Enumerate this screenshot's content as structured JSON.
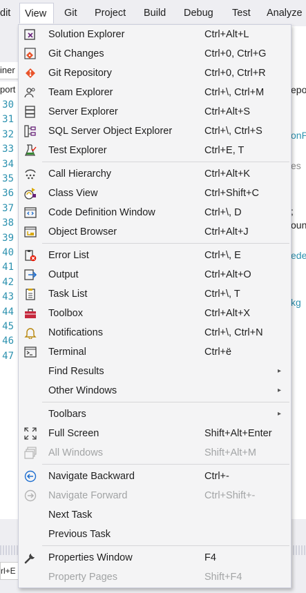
{
  "menubar": {
    "items": [
      "dit",
      "View",
      "Git",
      "Project",
      "Build",
      "Debug",
      "Test",
      "Analyze"
    ]
  },
  "background": {
    "tab_label": "iner",
    "port_label": "port",
    "line_numbers": [
      "30",
      "31",
      "32",
      "33",
      "34",
      "35",
      "36",
      "37",
      "38",
      "39",
      "40",
      "41",
      "42",
      "43",
      "44",
      "45",
      "46",
      "47"
    ],
    "right_fragments": [
      "epo",
      "onP",
      "es",
      ";",
      "oun",
      "ede",
      "kg"
    ],
    "bottom_field": "rl+E"
  },
  "view_menu": {
    "groups": [
      [
        {
          "label": "Solution Explorer",
          "shortcut": "Ctrl+Alt+L",
          "icon": "solution-explorer-icon"
        },
        {
          "label": "Git Changes",
          "shortcut": "Ctrl+0, Ctrl+G",
          "icon": "git-changes-icon"
        },
        {
          "label": "Git Repository",
          "shortcut": "Ctrl+0, Ctrl+R",
          "icon": "git-repository-icon"
        },
        {
          "label": "Team Explorer",
          "shortcut": "Ctrl+\\, Ctrl+M",
          "icon": "team-explorer-icon"
        },
        {
          "label": "Server Explorer",
          "shortcut": "Ctrl+Alt+S",
          "icon": "server-explorer-icon"
        },
        {
          "label": "SQL Server Object Explorer",
          "shortcut": "Ctrl+\\, Ctrl+S",
          "icon": "sql-server-icon"
        },
        {
          "label": "Test Explorer",
          "shortcut": "Ctrl+E, T",
          "icon": "test-explorer-icon"
        }
      ],
      [
        {
          "label": "Call Hierarchy",
          "shortcut": "Ctrl+Alt+K",
          "icon": "call-hierarchy-icon"
        },
        {
          "label": "Class View",
          "shortcut": "Ctrl+Shift+C",
          "icon": "class-view-icon"
        },
        {
          "label": "Code Definition Window",
          "shortcut": "Ctrl+\\, D",
          "icon": "code-definition-icon"
        },
        {
          "label": "Object Browser",
          "shortcut": "Ctrl+Alt+J",
          "icon": "object-browser-icon"
        }
      ],
      [
        {
          "label": "Error List",
          "shortcut": "Ctrl+\\, E",
          "icon": "error-list-icon"
        },
        {
          "label": "Output",
          "shortcut": "Ctrl+Alt+O",
          "icon": "output-icon"
        },
        {
          "label": "Task List",
          "shortcut": "Ctrl+\\, T",
          "icon": "task-list-icon"
        },
        {
          "label": "Toolbox",
          "shortcut": "Ctrl+Alt+X",
          "icon": "toolbox-icon"
        },
        {
          "label": "Notifications",
          "shortcut": "Ctrl+\\, Ctrl+N",
          "icon": "notifications-icon"
        },
        {
          "label": "Terminal",
          "shortcut": "Ctrl+ë",
          "icon": "terminal-icon"
        },
        {
          "label": "Find Results",
          "shortcut": "",
          "submenu": true
        },
        {
          "label": "Other Windows",
          "shortcut": "",
          "submenu": true
        }
      ],
      [
        {
          "label": "Toolbars",
          "shortcut": "",
          "submenu": true
        },
        {
          "label": "Full Screen",
          "shortcut": "Shift+Alt+Enter",
          "icon": "full-screen-icon"
        },
        {
          "label": "All Windows",
          "shortcut": "Shift+Alt+M",
          "icon": "all-windows-icon",
          "disabled": true
        }
      ],
      [
        {
          "label": "Navigate Backward",
          "shortcut": "Ctrl+-",
          "icon": "navigate-backward-icon"
        },
        {
          "label": "Navigate Forward",
          "shortcut": "Ctrl+Shift+-",
          "icon": "navigate-forward-icon",
          "disabled": true
        },
        {
          "label": "Next Task",
          "shortcut": ""
        },
        {
          "label": "Previous Task",
          "shortcut": ""
        }
      ],
      [
        {
          "label": "Properties Window",
          "shortcut": "F4",
          "icon": "properties-window-icon"
        },
        {
          "label": "Property Pages",
          "shortcut": "Shift+F4",
          "disabled": true
        }
      ]
    ],
    "submenu_arrow": "▸"
  },
  "colors": {
    "menu_bg": "#f4f4f5",
    "menubar_bg": "#eeeef2",
    "accent_blue": "#1f6fd0",
    "disabled_text": "#a2a4a5"
  }
}
